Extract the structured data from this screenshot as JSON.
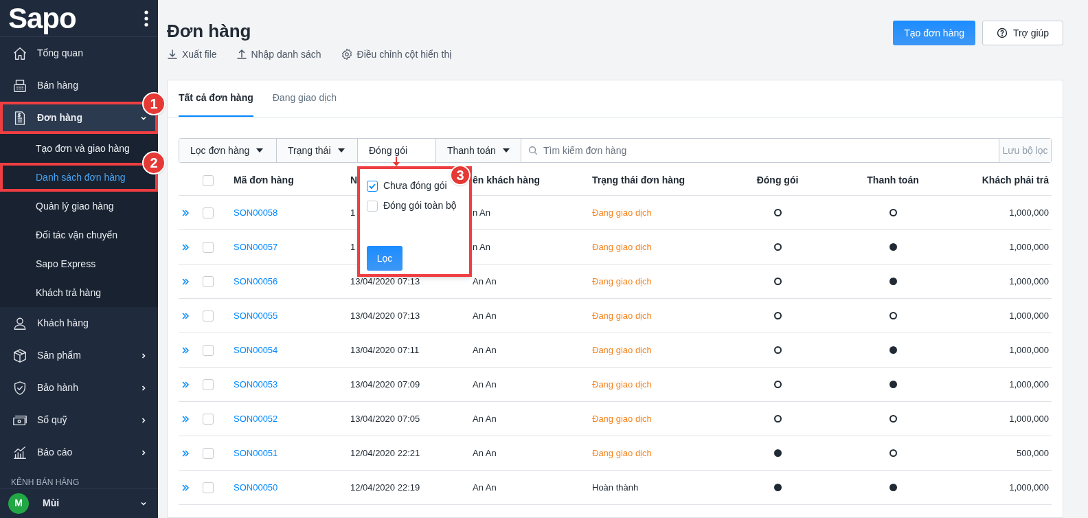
{
  "sidebar": {
    "logo": "Sapo",
    "items": [
      {
        "label": "Tổng quan",
        "selected": false
      },
      {
        "label": "Bán hàng",
        "selected": false
      },
      {
        "label": "Đơn hàng",
        "selected": true,
        "expanded": true,
        "children": [
          {
            "label": "Tạo đơn và giao hàng",
            "selected": false
          },
          {
            "label": "Danh sách đơn hàng",
            "selected": true
          },
          {
            "label": "Quản lý giao hàng",
            "selected": false
          },
          {
            "label": "Đối tác vận chuyển",
            "selected": false
          },
          {
            "label": "Sapo Express",
            "selected": false
          },
          {
            "label": "Khách trả hàng",
            "selected": false
          }
        ]
      },
      {
        "label": "Khách hàng",
        "selected": false
      },
      {
        "label": "Sản phẩm",
        "selected": false,
        "expanded": false
      },
      {
        "label": "Bảo hành",
        "selected": false,
        "expanded": false
      },
      {
        "label": "Sổ quỹ",
        "selected": false,
        "expanded": false
      },
      {
        "label": "Báo cáo",
        "selected": false,
        "expanded": false
      }
    ],
    "section_title": "KÊNH BÁN HÀNG",
    "user": {
      "initial": "M",
      "name": "Mùi"
    }
  },
  "page": {
    "title": "Đơn hàng",
    "actions": [
      "Xuất file",
      "Nhập danh sách",
      "Điều chỉnh cột hiển thị"
    ],
    "primary_button": "Tạo đơn hàng",
    "help_button": "Trợ giúp"
  },
  "tabs": [
    {
      "label": "Tất cả đơn hàng",
      "selected": true
    },
    {
      "label": "Đang giao dịch",
      "selected": false
    }
  ],
  "filters": [
    {
      "label": "Lọc đơn hàng",
      "open": false
    },
    {
      "label": "Trạng thái",
      "open": false
    },
    {
      "label": "Đóng gói",
      "open": true
    },
    {
      "label": "Thanh toán",
      "open": false
    }
  ],
  "search": {
    "placeholder": "Tìm kiếm đơn hàng"
  },
  "save_filter_button": "Lưu bộ lọc",
  "popover": {
    "options": [
      {
        "label": "Chưa đóng gói",
        "checked": true
      },
      {
        "label": "Đóng gói toàn bộ",
        "checked": false
      }
    ],
    "button": "Lọc"
  },
  "table": {
    "select_all_checked": false,
    "columns": [
      "Mã đơn hàng",
      "N",
      "ên khách hàng",
      "Trạng thái đơn hàng",
      "Đóng gói",
      "Thanh toán",
      "Khách phải trả"
    ],
    "rows": [
      {
        "checked": false,
        "code": "SON00058",
        "date": "1",
        "customer": "n An",
        "status": "Đang giao dịch",
        "color": "#f5841f",
        "packed": false,
        "paid": false,
        "amount": "1,000,000"
      },
      {
        "checked": false,
        "code": "SON00057",
        "date": "1",
        "customer": "n An",
        "status": "Đang giao dịch",
        "color": "#f5841f",
        "packed": false,
        "paid": true,
        "amount": "1,000,000"
      },
      {
        "checked": false,
        "code": "SON00056",
        "date": "13/04/2020 07:13",
        "customer": "An An",
        "status": "Đang giao dịch",
        "color": "#f5841f",
        "packed": false,
        "paid": true,
        "amount": "1,000,000"
      },
      {
        "checked": false,
        "code": "SON00055",
        "date": "13/04/2020 07:13",
        "customer": "An An",
        "status": "Đang giao dịch",
        "color": "#f5841f",
        "packed": false,
        "paid": false,
        "amount": "1,000,000"
      },
      {
        "checked": false,
        "code": "SON00054",
        "date": "13/04/2020 07:11",
        "customer": "An An",
        "status": "Đang giao dịch",
        "color": "#f5841f",
        "packed": false,
        "paid": true,
        "amount": "1,000,000"
      },
      {
        "checked": false,
        "code": "SON00053",
        "date": "13/04/2020 07:09",
        "customer": "An An",
        "status": "Đang giao dịch",
        "color": "#f5841f",
        "packed": false,
        "paid": true,
        "amount": "1,000,000"
      },
      {
        "checked": false,
        "code": "SON00052",
        "date": "13/04/2020 07:05",
        "customer": "An An",
        "status": "Đang giao dịch",
        "color": "#f5841f",
        "packed": false,
        "paid": false,
        "amount": "1,000,000"
      },
      {
        "checked": false,
        "code": "SON00051",
        "date": "12/04/2020 22:21",
        "customer": "An An",
        "status": "Đang giao dịch",
        "color": "#f5841f",
        "packed": true,
        "paid": false,
        "amount": "500,000"
      },
      {
        "checked": false,
        "code": "SON00050",
        "date": "12/04/2020 22:19",
        "customer": "An An",
        "status": "Hoàn thành",
        "color": "#212b35",
        "packed": true,
        "paid": true,
        "amount": "1,000,000"
      }
    ]
  },
  "annotations": [
    {
      "label": "1"
    },
    {
      "label": "2"
    },
    {
      "label": "3"
    }
  ]
}
